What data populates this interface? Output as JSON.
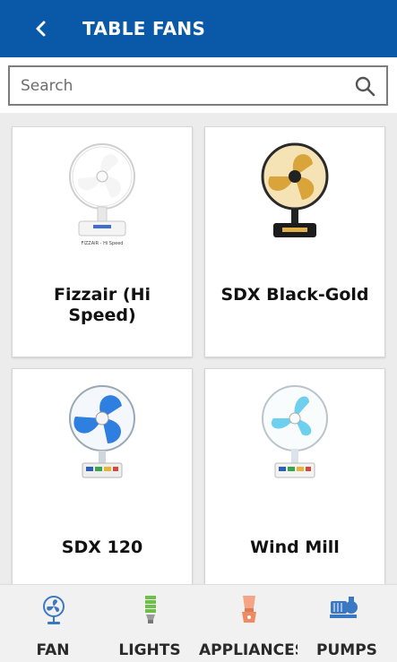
{
  "header": {
    "title": "TABLE FANS",
    "back_icon": "chevron-left-icon",
    "background": "#0a58a8"
  },
  "search": {
    "placeholder": "Search",
    "value": "",
    "icon": "search-icon"
  },
  "products": [
    {
      "name": "Fizzair (Hi Speed)",
      "blade_color": "#f5f5f5",
      "guard_color": "#cfcfcf",
      "base_color": "#f4f4f4",
      "image_caption": "FIZZAIR - Hi Speed"
    },
    {
      "name": "SDX Black-Gold",
      "blade_color": "#d9a43a",
      "guard_color": "#2a2a2a",
      "base_color": "#1c1c1c"
    },
    {
      "name": "SDX 120",
      "blade_color": "#2f7fe0",
      "guard_color": "#9aa7b5",
      "base_color": "#eeeeee"
    },
    {
      "name": "Wind Mill",
      "blade_color": "#6ed0ee",
      "guard_color": "#b9c4cc",
      "base_color": "#f3f3f3"
    }
  ],
  "bottom_nav": [
    {
      "label": "FAN",
      "icon": "fan-icon",
      "color": "#3b78c4"
    },
    {
      "label": "LIGHTS",
      "icon": "bulb-icon",
      "color": "#6fc04a"
    },
    {
      "label": "APPLIANCES",
      "icon": "mixer-icon",
      "color": "#f08a62"
    },
    {
      "label": "PUMPS",
      "icon": "pump-icon",
      "color": "#3b78c4"
    }
  ]
}
